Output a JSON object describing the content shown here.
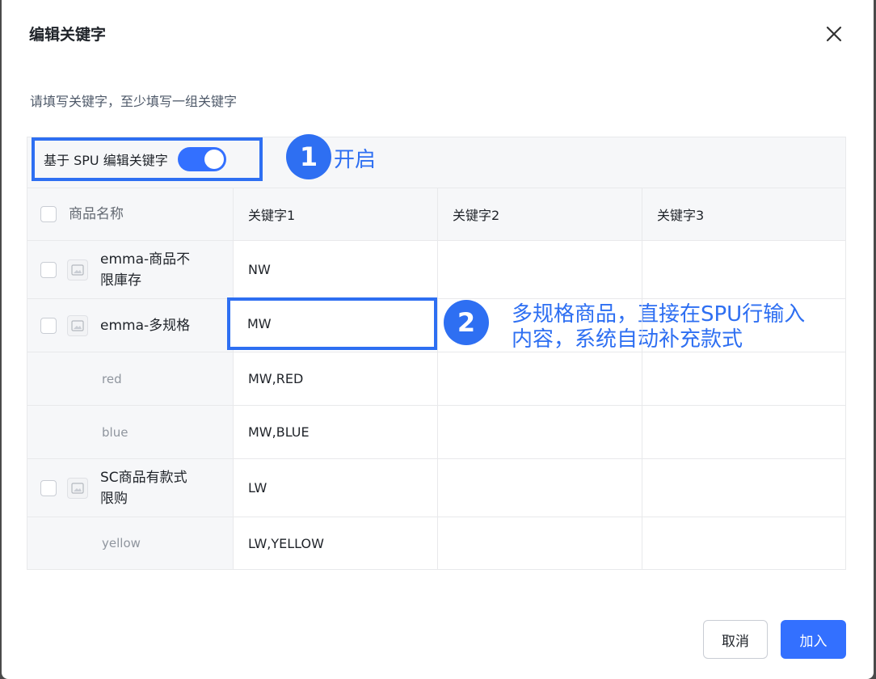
{
  "modal": {
    "title": "编辑关键字",
    "hint": "请填写关键字，至少填写一组关键字"
  },
  "toggle": {
    "label": "基于 SPU 编辑关键字",
    "enabled": true
  },
  "annotations": [
    {
      "number": "1",
      "text": "开启"
    },
    {
      "number": "2",
      "lines": [
        "多规格商品，直接在SPU行输入",
        "内容，系统自动补充款式"
      ]
    }
  ],
  "table": {
    "headers": [
      "商品名称",
      "关键字1",
      "关键字2",
      "关键字3"
    ],
    "rows": [
      {
        "type": "product",
        "name_lines": [
          "emma-商品不",
          "限庫存"
        ],
        "k1": "NW",
        "k2": "",
        "k3": ""
      },
      {
        "type": "product",
        "name_lines": [
          "emma-多规格"
        ],
        "k1": "MW",
        "k2": "",
        "k3": ""
      },
      {
        "type": "variant",
        "name_lines": [
          "red"
        ],
        "k1": "MW,RED",
        "k2": "",
        "k3": ""
      },
      {
        "type": "variant",
        "name_lines": [
          "blue"
        ],
        "k1": "MW,BLUE",
        "k2": "",
        "k3": ""
      },
      {
        "type": "product",
        "name_lines": [
          "SC商品有款式",
          "限购"
        ],
        "k1": "LW",
        "k2": "",
        "k3": ""
      },
      {
        "type": "variant",
        "name_lines": [
          "yellow"
        ],
        "k1": "LW,YELLOW",
        "k2": "",
        "k3": ""
      }
    ]
  },
  "buttons": {
    "cancel": "取消",
    "add": "加入"
  },
  "colors": {
    "primary": "#3370ff",
    "annotation": "#2e6ff2"
  }
}
